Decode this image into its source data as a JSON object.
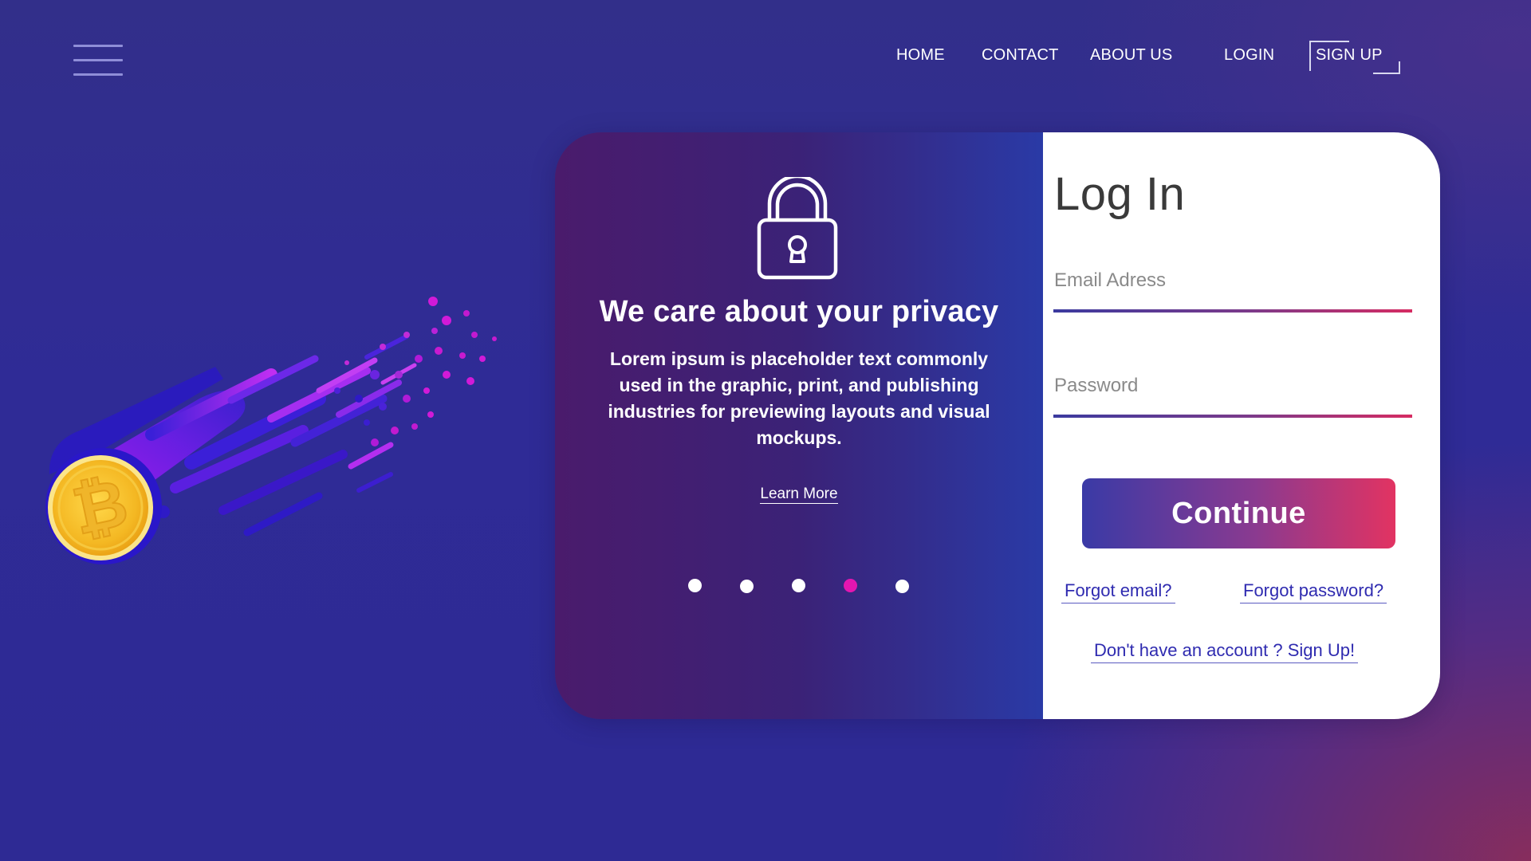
{
  "nav": {
    "menu_icon": "hamburger-menu-icon",
    "items": [
      {
        "label": "HOME"
      },
      {
        "label": "CONTACT"
      },
      {
        "label": "ABOUT US"
      },
      {
        "label": "LOGIN"
      },
      {
        "label": "SIGN UP"
      }
    ]
  },
  "illustration": {
    "icon": "bitcoin-coin-icon",
    "coin_color": "#f2b81f"
  },
  "privacy_panel": {
    "icon": "padlock-icon",
    "title": "We care about your privacy",
    "body": "Lorem ipsum is placeholder text commonly used in the graphic, print, and publishing industries for previewing layouts and visual mockups.",
    "learn_more": "Learn More",
    "carousel": {
      "count": 5,
      "active_index": 3,
      "active_color": "#e416b0"
    }
  },
  "login_form": {
    "title": "Log In",
    "email": {
      "placeholder": "Email Adress",
      "value": ""
    },
    "password": {
      "placeholder": "Password",
      "value": ""
    },
    "continue_label": "Continue",
    "forgot_email": "Forgot email?",
    "forgot_password": "Forgot password?",
    "signup_prompt": "Don't have an account ? Sign Up!"
  },
  "colors": {
    "background": "#2f2b96",
    "accent_gradient_start": "#3a3aa6",
    "accent_gradient_end": "#e23362",
    "link": "#2f2bb0"
  }
}
